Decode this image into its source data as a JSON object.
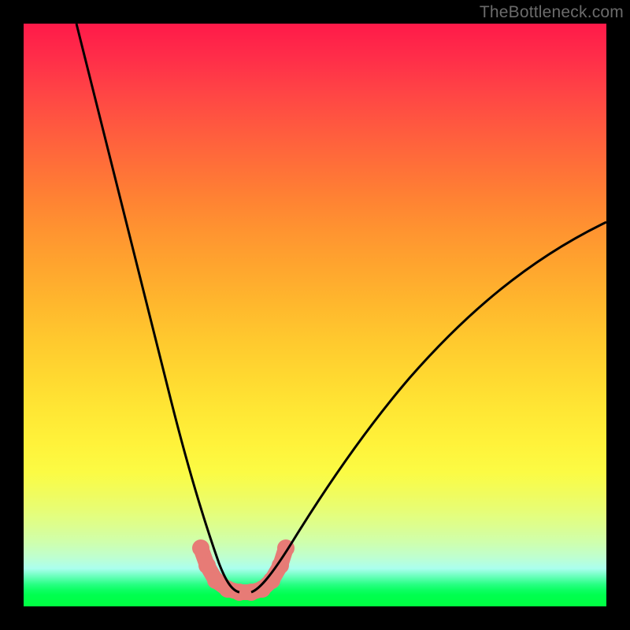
{
  "watermark": "TheBottleneck.com",
  "chart_data": {
    "type": "line",
    "title": "",
    "xlabel": "",
    "ylabel": "",
    "xlim": [
      0,
      100
    ],
    "ylim": [
      0,
      100
    ],
    "background": "rainbow-vertical-gradient",
    "series": [
      {
        "name": "left-curve",
        "x": [
          9,
          12,
          15,
          18,
          21,
          23,
          25,
          27,
          29,
          30.5,
          32,
          33.5,
          35,
          36,
          37
        ],
        "y": [
          100,
          88,
          75,
          63,
          51,
          42,
          34,
          27,
          20,
          15,
          11,
          8,
          5.5,
          4,
          3
        ],
        "stroke": "#000000",
        "width": 2.2
      },
      {
        "name": "right-curve",
        "x": [
          41,
          43,
          46,
          50,
          55,
          60,
          66,
          72,
          78,
          85,
          92,
          100
        ],
        "y": [
          3,
          5,
          9,
          15,
          22,
          29,
          36,
          43,
          49,
          55,
          60,
          66
        ],
        "stroke": "#000000",
        "width": 2.2
      },
      {
        "name": "bottom-marker-band",
        "x": [
          30.5,
          31.5,
          33,
          35,
          37,
          39,
          41,
          42.5,
          44,
          45
        ],
        "y": [
          10,
          7,
          4.5,
          3,
          2.5,
          2.5,
          3,
          4.5,
          7,
          10
        ],
        "stroke": "#e77b76",
        "width": 18,
        "markers": true
      }
    ]
  }
}
